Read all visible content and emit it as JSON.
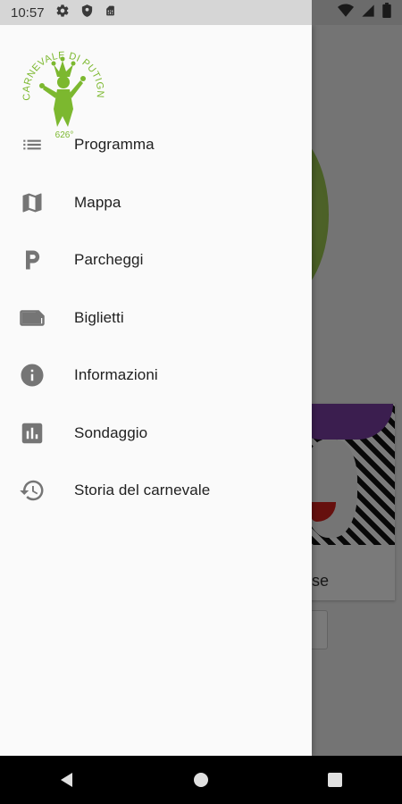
{
  "status_bar": {
    "time": "10:57",
    "left_icons": [
      "gear-icon",
      "shield-icon",
      "sim-card-icon"
    ],
    "right_icons": [
      "wifi-icon",
      "cellular-signal-icon",
      "battery-icon"
    ]
  },
  "drawer": {
    "logo": {
      "arc_text": "CARNEVALE DI PUTIGNANO",
      "edition": "626°",
      "color": "#7cb82f"
    },
    "menu": [
      {
        "label": "Programma",
        "icon": "list-icon"
      },
      {
        "label": "Mappa",
        "icon": "map-icon"
      },
      {
        "label": "Parcheggi",
        "icon": "parking-icon"
      },
      {
        "label": "Biglietti",
        "icon": "ticket-icon"
      },
      {
        "label": "Informazioni",
        "icon": "info-icon"
      },
      {
        "label": "Sondaggio",
        "icon": "poll-icon"
      },
      {
        "label": "Storia del carnevale",
        "icon": "history-icon"
      }
    ],
    "icon_color": "#757575"
  },
  "background": {
    "card_title": "ulisse"
  },
  "nav_bar": {
    "buttons": [
      "back-icon",
      "home-icon",
      "recents-icon"
    ]
  }
}
